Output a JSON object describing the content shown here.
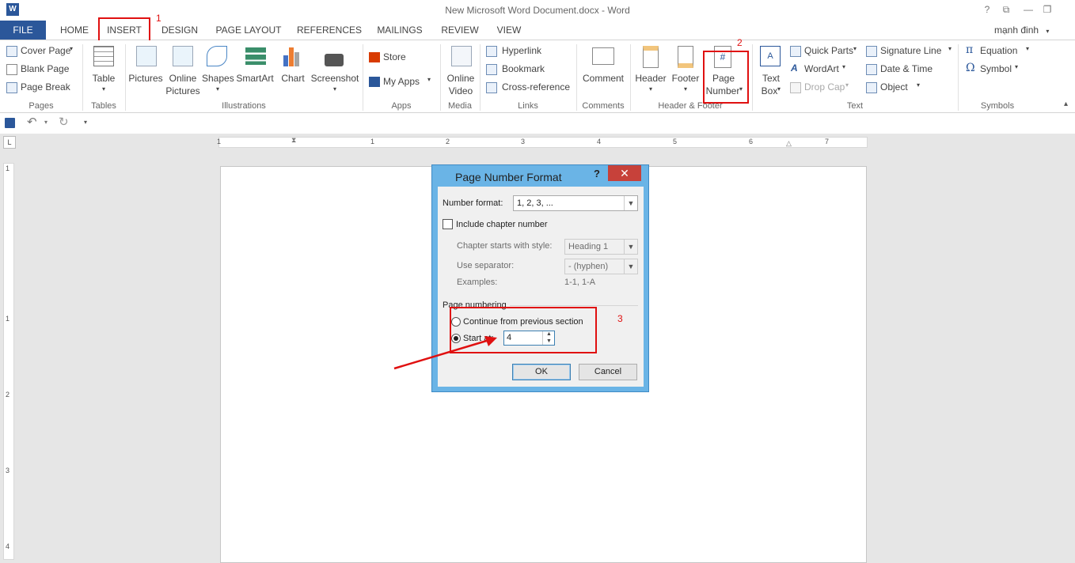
{
  "window": {
    "title": "New Microsoft Word Document.docx - Word",
    "app_icon_letter": "W",
    "controls": [
      "?",
      "⧉",
      "—",
      "❐"
    ],
    "user": "mạnh đinh"
  },
  "tabs": [
    "FILE",
    "HOME",
    "INSERT",
    "DESIGN",
    "PAGE LAYOUT",
    "REFERENCES",
    "MAILINGS",
    "REVIEW",
    "VIEW"
  ],
  "annotations": {
    "step1": "1",
    "step2": "2",
    "step3": "3"
  },
  "ribbon": {
    "pages": {
      "cover": "Cover Page",
      "blank": "Blank Page",
      "break": "Page Break",
      "group": "Pages"
    },
    "tables": {
      "table": "Table",
      "group": "Tables"
    },
    "illustrations": {
      "pictures": "Pictures",
      "online1": "Online",
      "online2": "Pictures",
      "shapes": "Shapes",
      "smartart": "SmartArt",
      "chart": "Chart",
      "screenshot": "Screenshot",
      "group": "Illustrations"
    },
    "apps": {
      "store": "Store",
      "myapps": "My Apps",
      "group": "Apps"
    },
    "media": {
      "online1": "Online",
      "online2": "Video",
      "group": "Media"
    },
    "links": {
      "hyperlink": "Hyperlink",
      "bookmark": "Bookmark",
      "crossref": "Cross-reference",
      "group": "Links"
    },
    "comments": {
      "comment": "Comment",
      "group": "Comments"
    },
    "header_footer": {
      "header": "Header",
      "footer": "Footer",
      "pn1": "Page",
      "pn2": "Number",
      "group": "Header & Footer"
    },
    "text": {
      "tb1": "Text",
      "tb2": "Box",
      "quickparts": "Quick Parts",
      "wordart": "WordArt",
      "dropcap": "Drop Cap",
      "sigline": "Signature Line",
      "datetime": "Date & Time",
      "object": "Object",
      "group": "Text"
    },
    "symbols": {
      "equation": "Equation",
      "symbol": "Symbol",
      "group": "Symbols"
    }
  },
  "ruler_numbers": [
    "1",
    "1",
    "2",
    "3",
    "4",
    "5",
    "6",
    "7"
  ],
  "vruler_numbers": [
    "1",
    "1",
    "2",
    "3",
    "4"
  ],
  "dialog": {
    "title": "Page Number Format",
    "help": "?",
    "close": "✕",
    "number_format_label": "Number format:",
    "number_format_value": "1, 2, 3, ...",
    "include_chapter": "Include chapter number",
    "chapter_style_label": "Chapter starts with style:",
    "chapter_style_value": "Heading 1",
    "separator_label": "Use separator:",
    "separator_value": "-   (hyphen)",
    "examples_label": "Examples:",
    "examples_value": "1-1, 1-A",
    "page_numbering": "Page numbering",
    "continue": "Continue from previous section",
    "start_at": "Start at:",
    "start_value": "4",
    "ok": "OK",
    "cancel": "Cancel"
  }
}
